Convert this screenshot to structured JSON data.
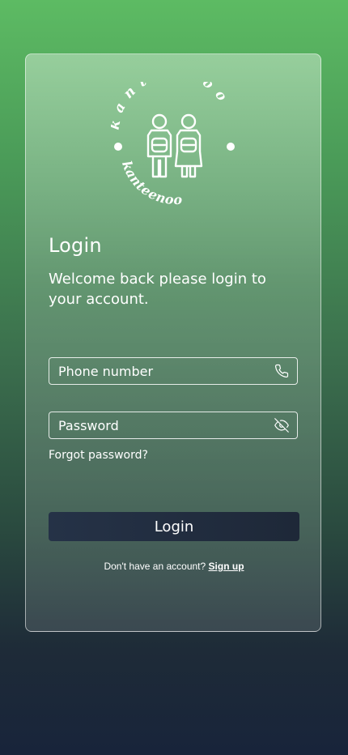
{
  "brand": {
    "arc_text_top": "kanteenoo",
    "arc_text_bottom": "kanteenoo"
  },
  "login": {
    "title": "Login",
    "subtitle": "Welcome back please login to your account.",
    "phone_placeholder": "Phone number",
    "password_placeholder": "Password",
    "forgot_label": "Forgot password?",
    "submit_label": "Login",
    "signup_prompt": "Don't have an account?",
    "signup_label": "Sign up"
  },
  "icons": {
    "phone": "phone-icon",
    "password_toggle": "eye-off-icon"
  },
  "colors": {
    "gradient_top": "#5dbb63",
    "gradient_bottom": "#18243a",
    "button": "#253247"
  }
}
